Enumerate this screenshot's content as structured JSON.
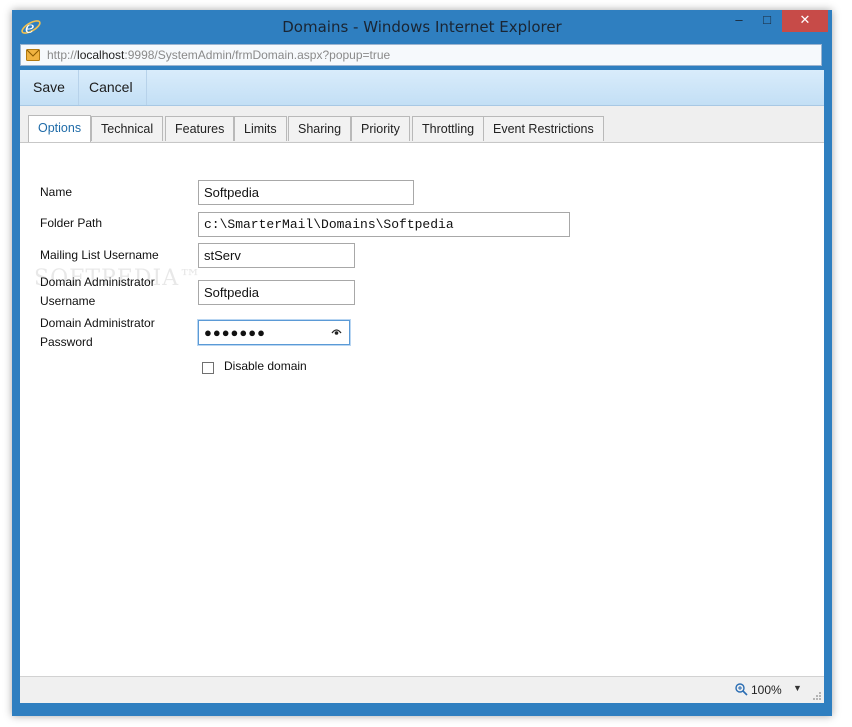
{
  "window": {
    "title": "Domains - Windows Internet Explorer",
    "minimize_glyph": "–",
    "maximize_glyph": "□",
    "close_glyph": "✕"
  },
  "address": {
    "scheme": "http://",
    "host": "localhost",
    "rest": ":9998/SystemAdmin/frmDomain.aspx?popup=true"
  },
  "toolbar": {
    "save_label": "Save",
    "cancel_label": "Cancel"
  },
  "tabs": [
    {
      "label": "Options",
      "active": true
    },
    {
      "label": "Technical"
    },
    {
      "label": "Features"
    },
    {
      "label": "Limits"
    },
    {
      "label": "Sharing"
    },
    {
      "label": "Priority"
    },
    {
      "label": "Throttling"
    },
    {
      "label": "Event Restrictions"
    }
  ],
  "form": {
    "name_label": "Name",
    "name_value": "Softpedia",
    "folder_label": "Folder Path",
    "folder_value": "c:\\SmarterMail\\Domains\\Softpedia",
    "mailing_label": "Mailing List Username",
    "mailing_value": "stServ",
    "admin_user_label_1": "Domain Administrator",
    "admin_user_label_2": "Username",
    "admin_user_value": "Softpedia",
    "admin_pwd_label_1": "Domain Administrator",
    "admin_pwd_label_2": "Password",
    "admin_pwd_value": "●●●●●●●",
    "disable_label": "Disable domain",
    "disable_checked": false
  },
  "status": {
    "zoom": "100%",
    "caret": "▼"
  },
  "watermark": "SOFTPEDIA™",
  "colors": {
    "chrome": "#2f7fc0",
    "close": "#c74b48",
    "toolbar": "#c3dff5",
    "active_tab_text": "#1f6ba8"
  },
  "icons": [
    "ie-logo-icon",
    "page-icon",
    "reveal-password-icon",
    "zoom-icon",
    "resize-grip-icon"
  ]
}
